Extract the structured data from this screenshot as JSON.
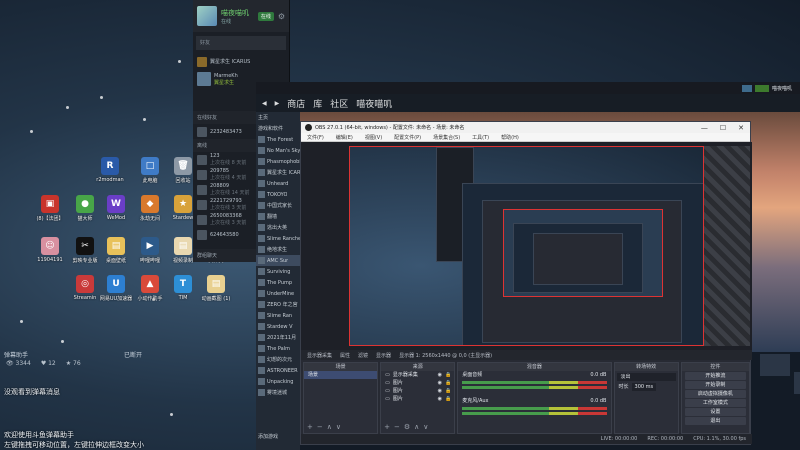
{
  "friends": {
    "user_name": "喵夜喵叽",
    "user_status": "在线",
    "status_button": "在线",
    "search_placeholder": "好友",
    "playing_game": "翼星求生 ICARUS",
    "friend_name": "MarmeKh",
    "friend_game": "翼星求生",
    "section_online": "在线好友",
    "friend_id": "2232483473",
    "section_offline": "离线",
    "list": [
      {
        "name": "123",
        "sub": "上次在线 8 天前"
      },
      {
        "name": "209785",
        "sub": "上次在线 4 天前"
      },
      {
        "name": "208809",
        "sub": "上次在线 14 天前"
      },
      {
        "name": "2221729793",
        "sub": "上次在线 3 天前"
      },
      {
        "name": "2650083368",
        "sub": "上次在线 3 天前"
      },
      {
        "name": "624643580",
        "sub": ""
      }
    ],
    "footer": "群组聊天"
  },
  "desktop_icons": [
    {
      "label": "r2modman",
      "color": "#2a5aa8",
      "glyph": "R"
    },
    {
      "label": "此电脑",
      "color": "#3f7bc6",
      "glyph": "□"
    },
    {
      "label": "回收站",
      "color": "#8d99a6",
      "glyph": "🗑"
    },
    {
      "label": "(8)【法团】",
      "color": "#c8342b",
      "glyph": "▣"
    },
    {
      "label": "猫大师",
      "color": "#48a548",
      "glyph": "●"
    },
    {
      "label": "WeMod",
      "color": "#6a3ec7",
      "glyph": "W"
    },
    {
      "label": "永劫无间",
      "color": "#d9792c",
      "glyph": "◆"
    },
    {
      "label": "Stardew",
      "color": "#d8a23a",
      "glyph": "★"
    },
    {
      "label": "11904191",
      "color": "#d890a0",
      "glyph": "☺"
    },
    {
      "label": "剪映专业版",
      "color": "#111111",
      "glyph": "✂"
    },
    {
      "label": "桌面壁纸",
      "color": "#e8c15a",
      "glyph": "▤"
    },
    {
      "label": "哔哩哔哩",
      "color": "#2d5a8a",
      "glyph": "▶"
    },
    {
      "label": "视频录制",
      "color": "#e9d8b0",
      "glyph": "▤"
    },
    {
      "label": "文件夹",
      "color": "#e0c070",
      "glyph": "▤"
    },
    {
      "label": "Streamin",
      "color": "#c93a3a",
      "glyph": "◎"
    },
    {
      "label": "网易UU加速器",
      "color": "#2d7fd1",
      "glyph": "U"
    },
    {
      "label": "小动作助手",
      "color": "#d94a3a",
      "glyph": "▲"
    },
    {
      "label": "TIM",
      "color": "#2d8fd6",
      "glyph": "T"
    },
    {
      "label": "动画截图 (1)",
      "color": "#e8d090",
      "glyph": "▤"
    }
  ],
  "chat": {
    "left_user": "弹幕助手",
    "right_user": "已断开",
    "stat_1": "3344",
    "stat_2": "12",
    "stat_3": "76",
    "line_1": "没观看到弹幕消息",
    "line_2": "欢迎使用斗鱼弹幕助手",
    "line_3": "左键拖拽可移动位置，左键拉伸边框改变大小"
  },
  "steam": {
    "nav_back": "◀",
    "nav_forward": "▶",
    "nav_store": "商店",
    "nav_library": "库",
    "nav_community": "社区",
    "nav_user": "喵夜喵叽",
    "lib_home": "主页",
    "lib_filter": "游戏和软件",
    "lib_items": [
      "The Forest",
      "No Man's Sky",
      "Phasmophobia",
      "翼星求生 ICARUS",
      "Unheard",
      "TOKOYO",
      "中国式家长",
      "翻墙",
      "逃出大英",
      "Slime Rancher",
      "绝地求生",
      "AMC Sur",
      "Surviving",
      "The Pump",
      "UnderMine",
      "ZERO 年之宫",
      "Slime Ran",
      "Stardew V",
      "2021年11月",
      "The Palm",
      "幻想的次元",
      "ASTRONEER",
      "Unpacking",
      "雾境迷城"
    ],
    "lib_add": "添加游戏"
  },
  "obs": {
    "title": "OBS 27.0.1 (64-bit, windows) - 配置文件: 未命名 - 场景: 未命名",
    "menu": [
      "文件(F)",
      "编辑(E)",
      "视图(V)",
      "配置文件(P)",
      "场景集合(S)",
      "工具(T)",
      "帮助(H)"
    ],
    "toolbar": [
      "显示器采集",
      "属性",
      "滤镜",
      "显示器",
      "显示器 1: 2560x1440 @ 0,0 (主显示器)"
    ],
    "docks": {
      "scenes": "场景",
      "scene_item": "场景",
      "sources": "来源",
      "source_items": [
        "显示器采集",
        "图片",
        "图片",
        "图片"
      ],
      "mixer": "混音器",
      "mixer_desktop": "桌面音频",
      "mixer_desktop_db": "0.0 dB",
      "mixer_mic": "麦克风/Aux",
      "mixer_mic_db": "0.0 dB",
      "transitions": "转场特效",
      "fade": "淡出",
      "duration_label": "时长",
      "duration": "300 ms",
      "controls": "控件",
      "control_buttons": [
        "开始推流",
        "开始录制",
        "启动虚拟摄像机",
        "工作室模式",
        "设置",
        "退出"
      ]
    },
    "status": [
      "LIVE: 00:00:00",
      "REC: 00:00:00",
      "CPU: 1.1%, 30.00 fps"
    ]
  }
}
